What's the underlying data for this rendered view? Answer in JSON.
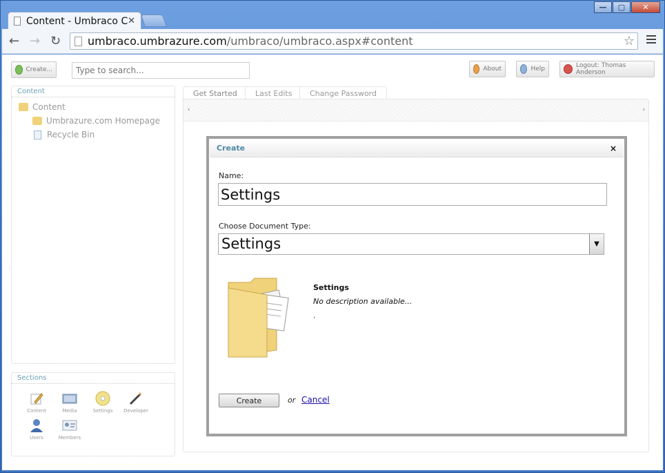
{
  "browser": {
    "tab_title": "Content - Umbraco C",
    "url_host": "umbraco.umbrazure.com",
    "url_path": "/umbraco/umbraco.aspx#content"
  },
  "topbar": {
    "create_label": "Create...",
    "search_placeholder": "Type to search...",
    "about_label": "About",
    "help_label": "Help",
    "logout_label": "Logout: Thomas Anderson"
  },
  "content_panel": {
    "title": "Content",
    "tree": [
      {
        "label": "Content"
      },
      {
        "label": "Umbrazure.com Homepage"
      },
      {
        "label": "Recycle Bin"
      }
    ]
  },
  "sections_panel": {
    "title": "Sections",
    "items": [
      {
        "label": "Content"
      },
      {
        "label": "Media"
      },
      {
        "label": "Settings"
      },
      {
        "label": "Developer"
      },
      {
        "label": "Users"
      },
      {
        "label": "Members"
      }
    ]
  },
  "tabs": [
    {
      "label": "Get Started"
    },
    {
      "label": "Last Edits"
    },
    {
      "label": "Change Password"
    }
  ],
  "modal": {
    "title": "Create",
    "close": "×",
    "name_label": "Name:",
    "name_value": "Settings",
    "doctype_label": "Choose Document Type:",
    "doctype_value": "Settings",
    "type_name": "Settings",
    "type_description": "No description available...",
    "create_button": "Create",
    "or_text": "or",
    "cancel_link": "Cancel"
  },
  "colors": {
    "accent_title": "#4f8aa8",
    "link": "#1a0dab",
    "folder": "#f0d27a"
  }
}
